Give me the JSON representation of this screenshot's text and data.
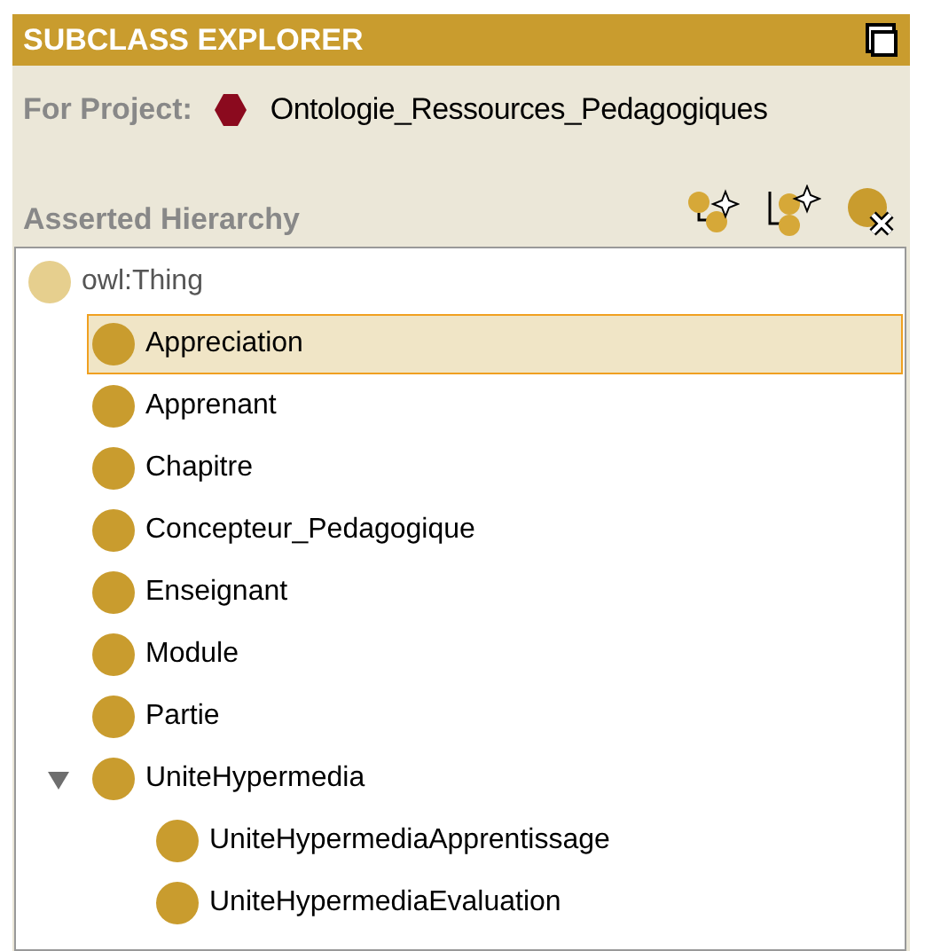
{
  "panel": {
    "title": "SUBCLASS EXPLORER",
    "project_label": "For Project:",
    "project_name": "Ontologie_Ressources_Pedagogiques",
    "hierarchy_label": "Asserted Hierarchy"
  },
  "tree": [
    {
      "label": "owl:Thing",
      "kind": "root",
      "selected": false,
      "children": [
        {
          "label": "Appreciation",
          "kind": "class",
          "selected": true
        },
        {
          "label": "Apprenant",
          "kind": "class",
          "selected": false
        },
        {
          "label": "Chapitre",
          "kind": "class",
          "selected": false
        },
        {
          "label": "Concepteur_Pedagogique",
          "kind": "class",
          "selected": false
        },
        {
          "label": "Enseignant",
          "kind": "class",
          "selected": false
        },
        {
          "label": "Module",
          "kind": "class",
          "selected": false
        },
        {
          "label": "Partie",
          "kind": "class",
          "selected": false
        },
        {
          "label": "UniteHypermedia",
          "kind": "class",
          "selected": false,
          "expanded": true,
          "children": [
            {
              "label": "UniteHypermediaApprentissage",
              "kind": "class",
              "selected": false
            },
            {
              "label": "UniteHypermediaEvaluation",
              "kind": "class",
              "selected": false
            }
          ]
        }
      ]
    }
  ]
}
